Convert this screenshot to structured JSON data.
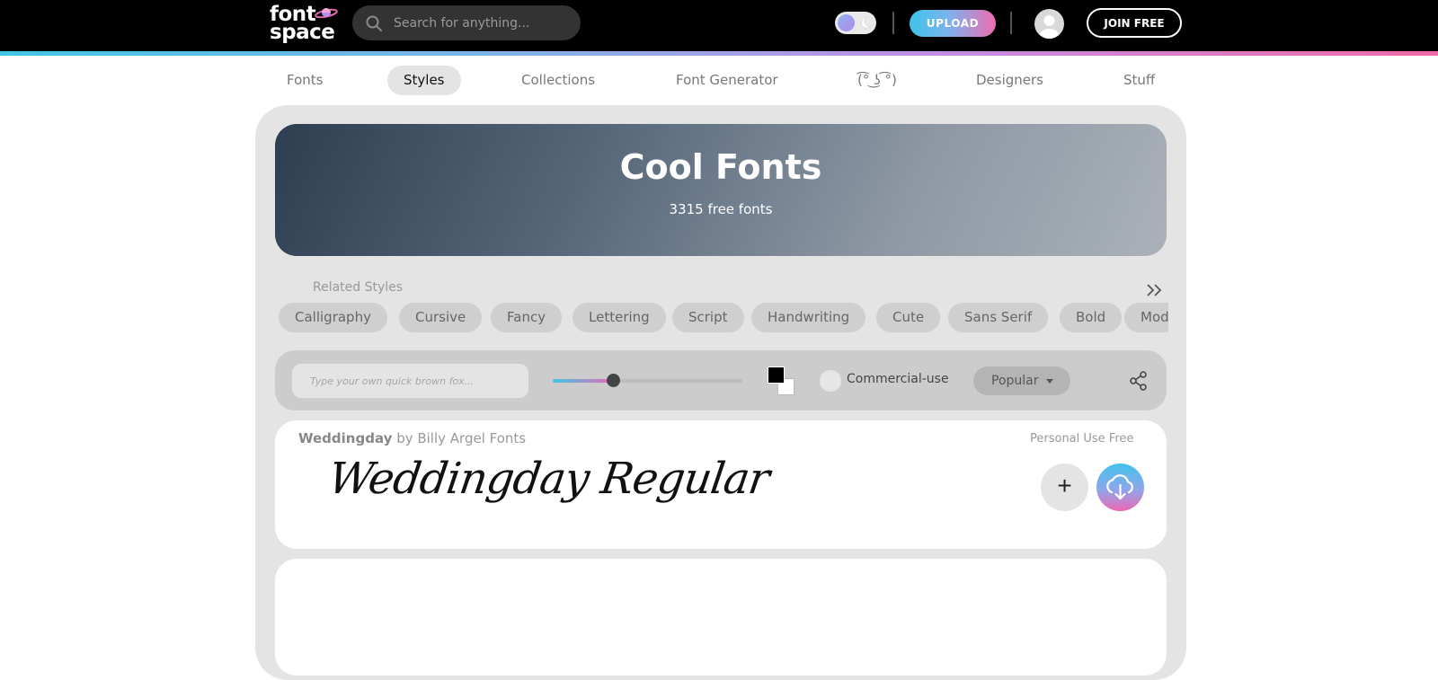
{
  "header": {
    "logo_line1": "font",
    "logo_line2": "space",
    "search_placeholder": "Search for anything...",
    "upload_label": "UPLOAD",
    "join_label": "JOIN FREE"
  },
  "nav": {
    "items": [
      {
        "label": "Fonts"
      },
      {
        "label": "Styles"
      },
      {
        "label": "Collections"
      },
      {
        "label": "Font Generator"
      },
      {
        "label": "(͡° ͜ʖ ͡°)"
      },
      {
        "label": "Designers"
      },
      {
        "label": "Stuff"
      }
    ]
  },
  "hero": {
    "title": "Cool Fonts",
    "count": "3315 free fonts"
  },
  "related": {
    "title": "Related Styles",
    "chips": [
      "Calligraphy",
      "Cursive",
      "Fancy",
      "Lettering",
      "Script",
      "Handwriting",
      "Cute",
      "Sans Serif",
      "Bold",
      "Modern"
    ]
  },
  "toolbar": {
    "input_placeholder": "Type your own quick brown fox...",
    "size_fraction": 0.32,
    "commercial_label": "Commercial-use",
    "sort_label": "Popular",
    "fg_color": "#000000",
    "bg_color": "#ffffff"
  },
  "fonts": [
    {
      "name": "Weddingday",
      "by": "by Billy Argel Fonts",
      "license": "Personal Use Free",
      "preview": "Weddingday Regular",
      "add_symbol": "+"
    }
  ],
  "colors": {
    "accent_cyan": "#42c6e8",
    "accent_pink": "#f06aa8",
    "panel_bg": "#e4e4e4"
  },
  "icons": [
    "planet-logo-icon",
    "search-icon",
    "moon-icon",
    "avatar-icon",
    "double-chevron-right-icon",
    "caret-down-icon",
    "share-icon",
    "plus-icon",
    "cloud-download-icon"
  ]
}
